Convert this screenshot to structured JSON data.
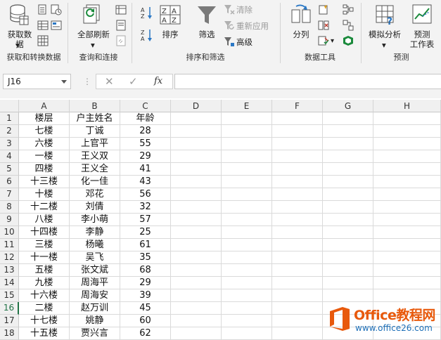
{
  "ribbon": {
    "groups": [
      {
        "label": "获取和转换数据",
        "buttons": [
          {
            "label": "获取数据"
          }
        ]
      },
      {
        "label": "查询和连接",
        "buttons": [
          {
            "label": "全部刷新"
          }
        ]
      },
      {
        "label": "排序和筛选",
        "buttons": [
          {
            "label": "排序"
          },
          {
            "label": "筛选"
          },
          {
            "label": "清除"
          },
          {
            "label": "重新应用"
          },
          {
            "label": "高级"
          }
        ]
      },
      {
        "label": "数据工具",
        "buttons": [
          {
            "label": "分列"
          }
        ]
      },
      {
        "label": "预测",
        "buttons": [
          {
            "label": "模拟分析"
          },
          {
            "label": "预测工作表"
          }
        ]
      }
    ]
  },
  "formula_bar": {
    "name_box": "J16",
    "fx": "fx",
    "formula": ""
  },
  "columns": [
    "A",
    "B",
    "C",
    "D",
    "E",
    "F",
    "G",
    "H"
  ],
  "rows": [
    {
      "n": "1",
      "a": "楼层",
      "b": "户主姓名",
      "c": "年龄"
    },
    {
      "n": "2",
      "a": "七楼",
      "b": "丁诚",
      "c": "28"
    },
    {
      "n": "3",
      "a": "六楼",
      "b": "上官平",
      "c": "55"
    },
    {
      "n": "4",
      "a": "一楼",
      "b": "王义双",
      "c": "29"
    },
    {
      "n": "5",
      "a": "四楼",
      "b": "王义全",
      "c": "41"
    },
    {
      "n": "6",
      "a": "十三楼",
      "b": "化一佳",
      "c": "43"
    },
    {
      "n": "7",
      "a": "十楼",
      "b": "邓花",
      "c": "56"
    },
    {
      "n": "8",
      "a": "十二楼",
      "b": "刘倩",
      "c": "32"
    },
    {
      "n": "9",
      "a": "八楼",
      "b": "李小萌",
      "c": "57"
    },
    {
      "n": "10",
      "a": "十四楼",
      "b": "李静",
      "c": "25"
    },
    {
      "n": "11",
      "a": "三楼",
      "b": "杨曦",
      "c": "61"
    },
    {
      "n": "12",
      "a": "十一楼",
      "b": "吴飞",
      "c": "35"
    },
    {
      "n": "13",
      "a": "五楼",
      "b": "张文斌",
      "c": "68"
    },
    {
      "n": "14",
      "a": "九楼",
      "b": "周海平",
      "c": "29"
    },
    {
      "n": "15",
      "a": "十六楼",
      "b": "周海安",
      "c": "39"
    },
    {
      "n": "16",
      "a": "二楼",
      "b": "赵万训",
      "c": "45"
    },
    {
      "n": "17",
      "a": "十七楼",
      "b": "姚静",
      "c": "60"
    },
    {
      "n": "18",
      "a": "十五楼",
      "b": "贾兴言",
      "c": "62"
    }
  ],
  "active_row": "16",
  "watermark": {
    "line1": "Office教程网",
    "line2": "www.office26.com"
  },
  "colors": {
    "accent": "#217346",
    "watermark_orange": "#e8590c",
    "watermark_blue": "#1d6fb8"
  }
}
